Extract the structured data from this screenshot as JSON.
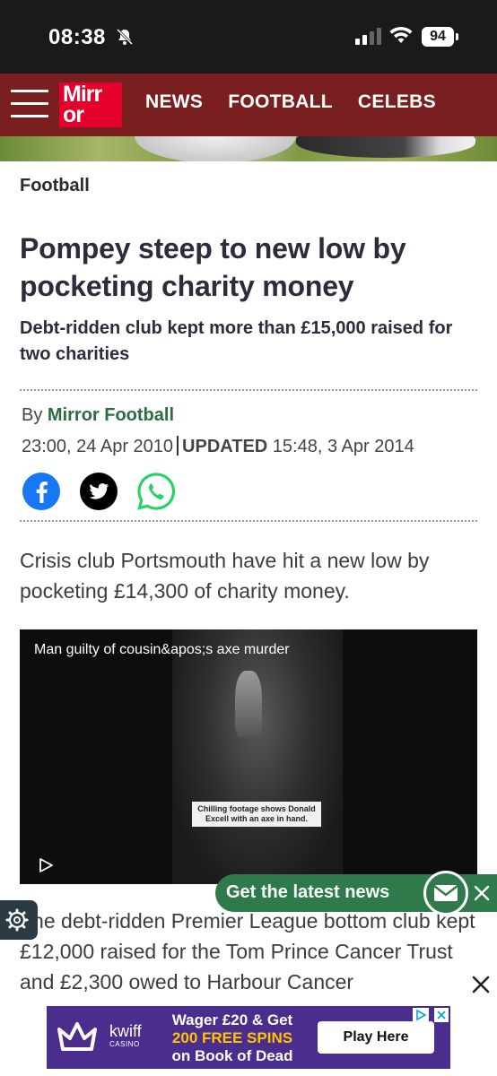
{
  "status_bar": {
    "time": "08:38",
    "battery": "94"
  },
  "nav": {
    "logo_line1": "Mirr",
    "logo_line2": "or",
    "links": [
      "NEWS",
      "FOOTBALL",
      "CELEBS"
    ]
  },
  "article": {
    "section": "Football",
    "headline": "Pompey steep to new low by pocketing charity money",
    "standfirst": "Debt-ridden club kept more than £15,000 raised for two charities",
    "byline_prefix": "By",
    "author": "Mirror Football",
    "published": "23:00, 24 Apr 2010",
    "updated_label": "UPDATED",
    "updated": "15:48, 3 Apr 2014",
    "para1": "Crisis club Portsmouth have hit a new low by pocketing £14,300 of charity money.",
    "para2": "The debt-ridden Premier League bottom club kept £12,000 raised for the Tom Prince Cancer Trust and £2,300 owed to Harbour Cancer"
  },
  "video": {
    "title": "Man guilty of cousin&apos;s axe murder",
    "caption": "Chilling footage shows Donald Excell with an axe in hand."
  },
  "newsbar": {
    "text": "Get the latest news"
  },
  "ad": {
    "brand": "kwiff",
    "brand_sub": "CASINO",
    "line1": "Wager £20 & Get",
    "line2": "200 FREE SPINS",
    "line3": "on Book of Dead",
    "cta": "Play Here"
  },
  "colors": {
    "nav_bg": "#7a1f1f",
    "logo_red": "#e4002b",
    "accent_green": "#2e7a4a",
    "ad_purple": "#4a2d8c"
  }
}
